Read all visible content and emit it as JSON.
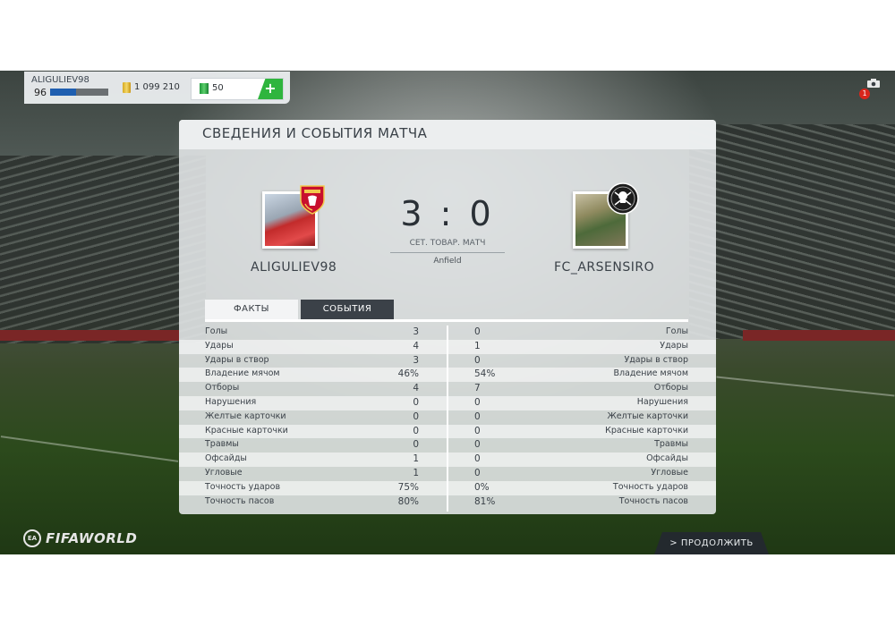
{
  "topbar": {
    "player_name": "ALIGULIEV98",
    "level": "96",
    "level_progress": 0.45,
    "coins": "1 099 210",
    "points": "50",
    "add_label": "+",
    "notification_count": "1"
  },
  "panel": {
    "title": "СВЕДЕНИЯ И СОБЫТИЯ МАТЧА",
    "home_team": "ALIGULIEV98",
    "away_team": "FC_ARSENSIRO",
    "score": "3 : 0",
    "match_type": "СЕТ. ТОВАР. МАТЧ",
    "venue": "Anfield",
    "tabs": [
      "ФАКТЫ",
      "СОБЫТИЯ"
    ]
  },
  "stats": [
    {
      "label": "Голы",
      "home": "3",
      "away": "0"
    },
    {
      "label": "Удары",
      "home": "4",
      "away": "1"
    },
    {
      "label": "Удары в створ",
      "home": "3",
      "away": "0"
    },
    {
      "label": "Владение мячом",
      "home": "46%",
      "away": "54%"
    },
    {
      "label": "Отборы",
      "home": "4",
      "away": "7"
    },
    {
      "label": "Нарушения",
      "home": "0",
      "away": "0"
    },
    {
      "label": "Желтые карточки",
      "home": "0",
      "away": "0"
    },
    {
      "label": "Красные карточки",
      "home": "0",
      "away": "0"
    },
    {
      "label": "Травмы",
      "home": "0",
      "away": "0"
    },
    {
      "label": "Офсайды",
      "home": "1",
      "away": "0"
    },
    {
      "label": "Угловые",
      "home": "1",
      "away": "0"
    },
    {
      "label": "Точность ударов",
      "home": "75%",
      "away": "0%"
    },
    {
      "label": "Точность пасов",
      "home": "80%",
      "away": "81%"
    }
  ],
  "footer": {
    "logo_badge": "EA",
    "logo_text": "FIFAWORLD",
    "continue_label": "> ПРОДОЛЖИТЬ"
  },
  "icons": {
    "coins": "coins-icon",
    "points": "fifa-points-icon",
    "camera": "camera-icon"
  },
  "colors": {
    "accent_green": "#2fb53e",
    "level_blue": "#1f5fb0",
    "tab_dark": "#3b4148"
  }
}
